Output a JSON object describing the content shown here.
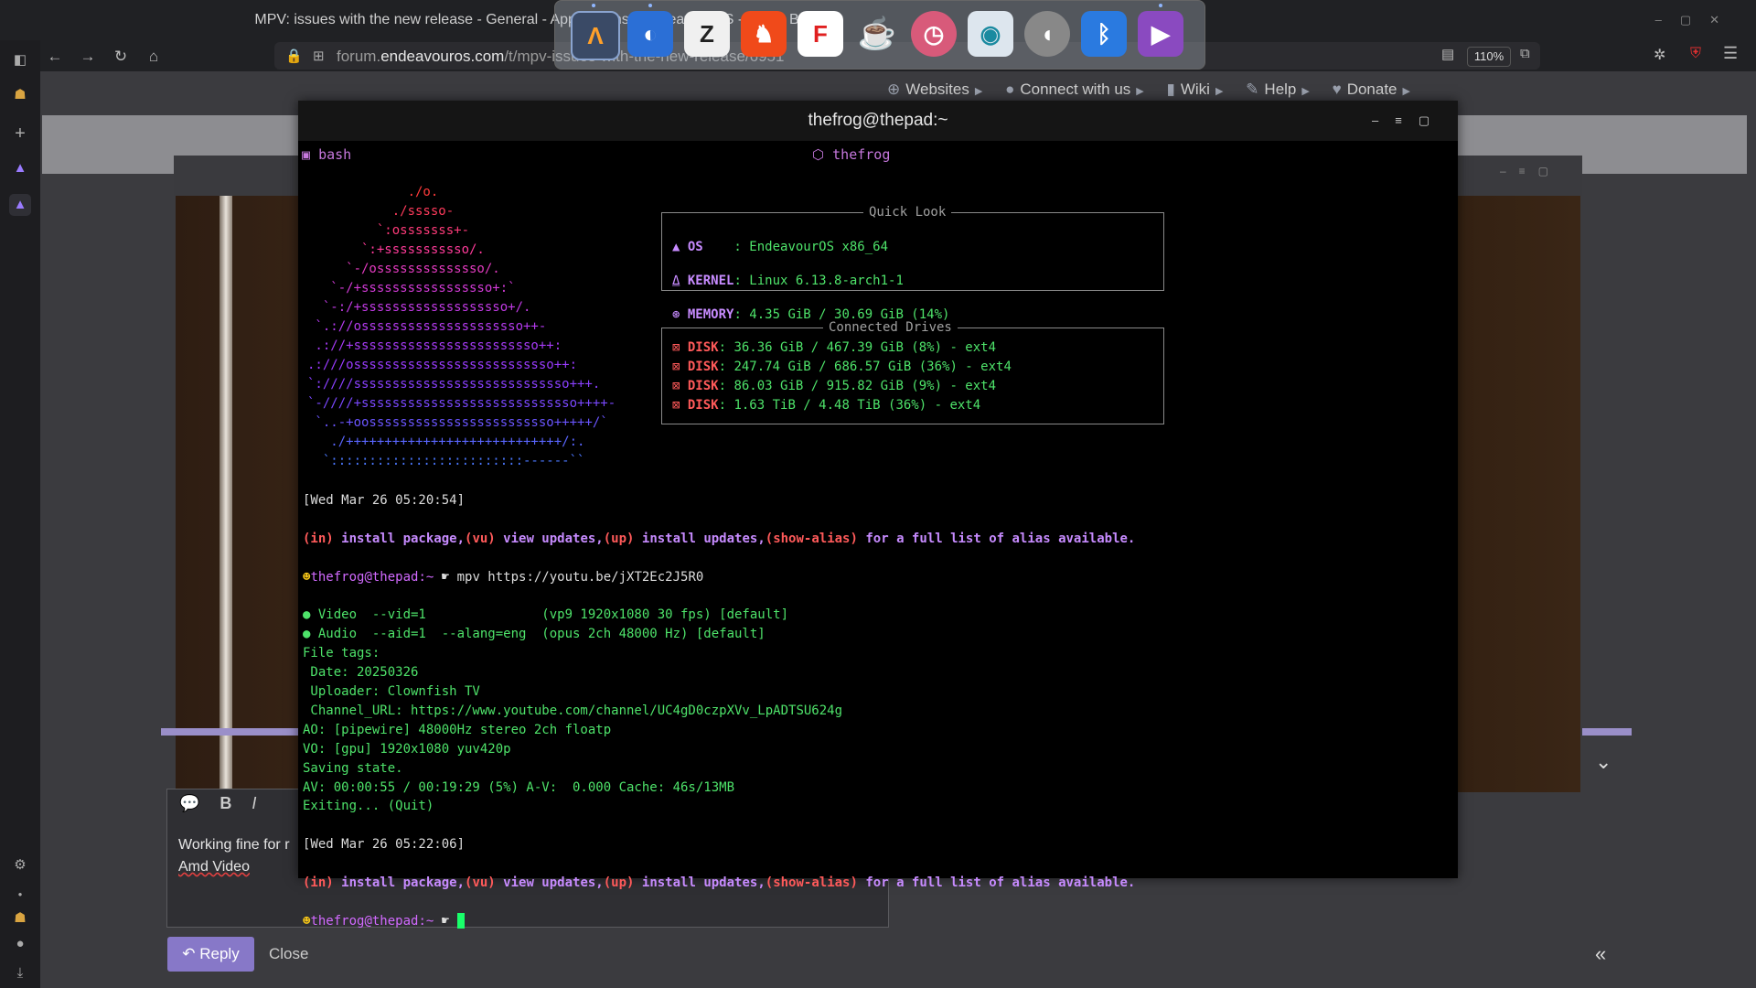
{
  "browser": {
    "window_title": "MPV: issues with the new release - General - Applications - EndeavourOS - Brave Browser",
    "url_host_prefix": "forum.",
    "url_host": "endeavouros.com",
    "url_path": "/t/mpv-issues-with-the-new-release/6951",
    "zoom": "110%"
  },
  "dock": {
    "apps": [
      "endeavouros-icon",
      "file-manager-icon",
      "zed-icon",
      "brave-icon",
      "flameshot-icon",
      "teapot-icon",
      "clock-icon",
      "screenshot-icon",
      "volume-icon",
      "bluetooth-icon",
      "media-player-icon"
    ]
  },
  "site_nav": {
    "items": [
      {
        "label": "Websites",
        "icon": "globe-icon"
      },
      {
        "label": "Connect with us",
        "icon": "person-icon"
      },
      {
        "label": "Wiki",
        "icon": "book-icon"
      },
      {
        "label": "Help",
        "icon": "wrench-icon"
      },
      {
        "label": "Donate",
        "icon": "heart-icon"
      }
    ]
  },
  "composer": {
    "line1": "Working fine for r",
    "line2": "Amd Video",
    "reply_label": "Reply",
    "close_label": "Close"
  },
  "terminal": {
    "title": "thefrog@thepad:~",
    "tab_label": "bash",
    "user_label": "thefrog",
    "logo": [
      "             ./o.",
      "           ./sssso-",
      "         `:osssssss+-",
      "       `:+sssssssssso/.",
      "     `-/ossssssssssssso/.",
      "   `-/+sssssssssssssssso+:`",
      "  `-:/+sssssssssssssssssso+/.",
      " `.://osssssssssssssssssssso++-",
      " .://+ssssssssssssssssssssssso++:",
      ".:///ossssssssssssssssssssssssso++:",
      "`:////ssssssssssssssssssssssssssso+++.",
      "`-////+ssssssssssssssssssssssssssso++++-",
      " `..-+oossssssssssssssssssssssso+++++/`",
      "   ./++++++++++++++++++++++++++++/:.",
      "  `:::::::::::::::::::::::::------``"
    ],
    "quick_look": {
      "title": "Quick Look",
      "os_label": "OS",
      "os_value": "EndeavourOS x86_64",
      "kernel_label": "KERNEL",
      "kernel_value": "Linux 6.13.8-arch1-1",
      "memory_label": "MEMORY",
      "memory_value": "4.35 GiB / 30.69 GiB (14%)"
    },
    "drives": {
      "title": "Connected Drives",
      "label": "DISK",
      "items": [
        "36.36 GiB / 467.39 GiB (8%) - ext4",
        "247.74 GiB / 686.57 GiB (36%) - ext4",
        "86.03 GiB / 915.82 GiB (9%) - ext4",
        "1.63 TiB / 4.48 TiB (36%) - ext4"
      ]
    },
    "output": {
      "timestamp1": "[Wed Mar 26 05:20:54]",
      "alias_in": "(in)",
      "alias_in_text": " install package,",
      "alias_vu": "(vu)",
      "alias_vu_text": " view updates,",
      "alias_up": "(up)",
      "alias_up_text": " install updates,",
      "alias_show": "(show-alias)",
      "alias_show_text": " for a full list of alias available.",
      "prompt": "thefrog@thepad:~",
      "command": " mpv https://youtu.be/jXT2Ec2J5R0",
      "lines": [
        "● Video  --vid=1               (vp9 1920x1080 30 fps) [default]",
        "● Audio  --aid=1  --alang=eng  (opus 2ch 48000 Hz) [default]",
        "File tags:",
        " Date: 20250326",
        " Uploader: Clownfish TV",
        " Channel_URL: https://www.youtube.com/channel/UC4gD0czpXVv_LpADTSU624g",
        "AO: [pipewire] 48000Hz stereo 2ch floatp",
        "VO: [gpu] 1920x1080 yuv420p",
        "Saving state.",
        "AV: 00:00:55 / 00:19:29 (5%) A-V:  0.000 Cache: 46s/13MB",
        "Exiting... (Quit)"
      ],
      "timestamp2": "[Wed Mar 26 05:22:06]"
    }
  }
}
